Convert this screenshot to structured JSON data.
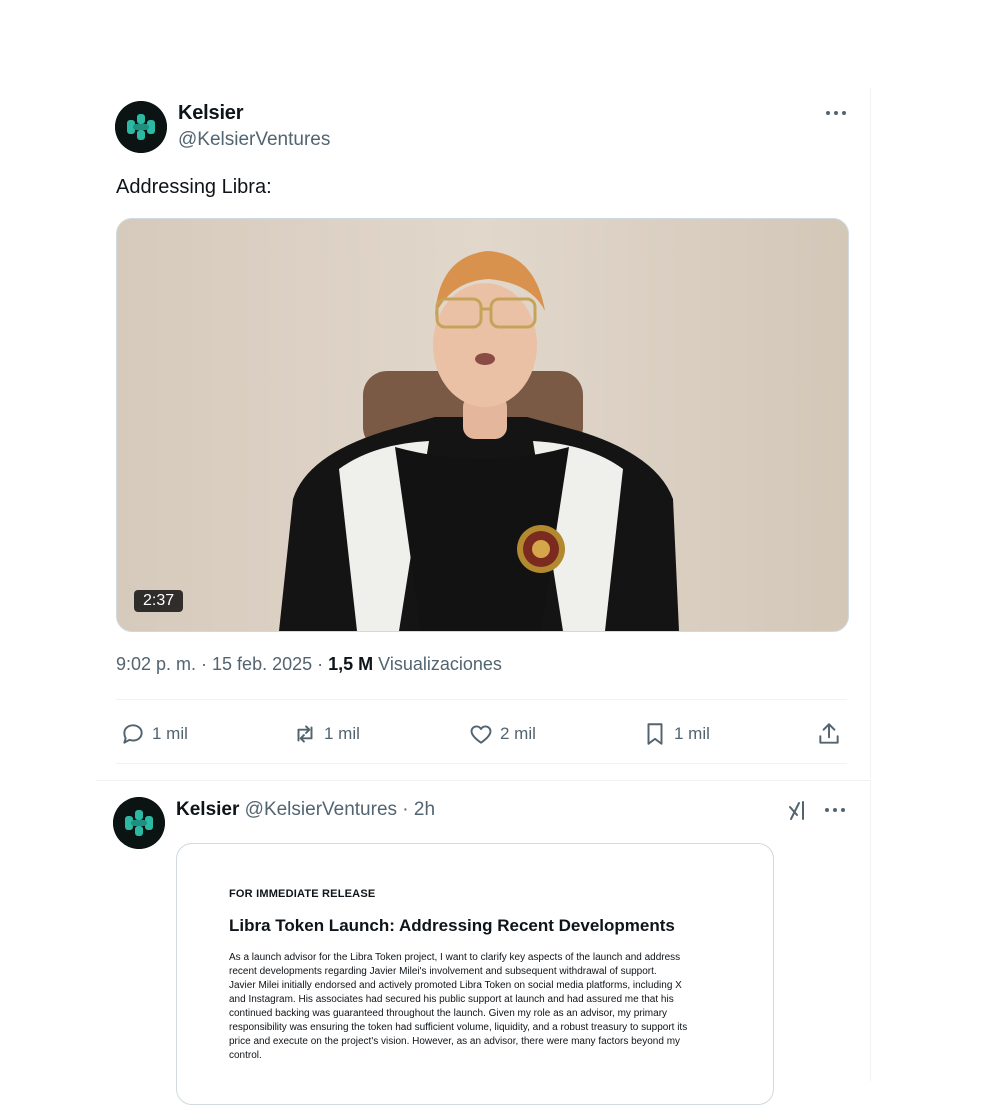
{
  "tweet": {
    "name": "Kelsier",
    "handle": "@KelsierVentures",
    "text": "Addressing Libra:",
    "video_duration": "2:37",
    "timestamp": "9:02 p. m. · 15 feb. 2025 · ",
    "views_count": "1,5 M",
    "views_label": " Visualizaciones",
    "actions": {
      "replies": "1 mil",
      "reposts": "1 mil",
      "likes": "2 mil",
      "bookmarks": "1 mil"
    },
    "icons": [
      "more-icon",
      "reply-icon",
      "repost-icon",
      "like-icon",
      "bookmark-icon",
      "share-icon"
    ]
  },
  "embedded_tweet": {
    "name": "Kelsier",
    "handle_time": " @KelsierVentures · 2h",
    "icons": [
      "grok-icon",
      "more-icon"
    ],
    "document": {
      "eyebrow": "FOR IMMEDIATE RELEASE",
      "title": "Libra Token Launch: Addressing Recent Developments",
      "lines": [
        "As a launch advisor for the Libra Token project, I want to clarify key aspects of the launch and address",
        "recent developments regarding Javier Milei's involvement and subsequent withdrawal of support.",
        "Javier Milei initially endorsed and actively promoted Libra Token on social media platforms, including X",
        "and Instagram. His associates had secured his public support at launch and had assured me that his",
        "continued backing was guaranteed throughout the launch. Given my role as an advisor, my primary",
        "responsibility was ensuring the token had sufficient volume, liquidity, and a robust treasury to support its",
        "price and execute on the project's vision. However, as an advisor, there were many factors beyond my",
        "control."
      ]
    }
  },
  "colors": {
    "text_primary": "#0f1419",
    "text_secondary": "#536471",
    "border": "#cfd9de",
    "avatar_bg": "#0b1413",
    "avatar_accent": "#2bb9a4"
  }
}
